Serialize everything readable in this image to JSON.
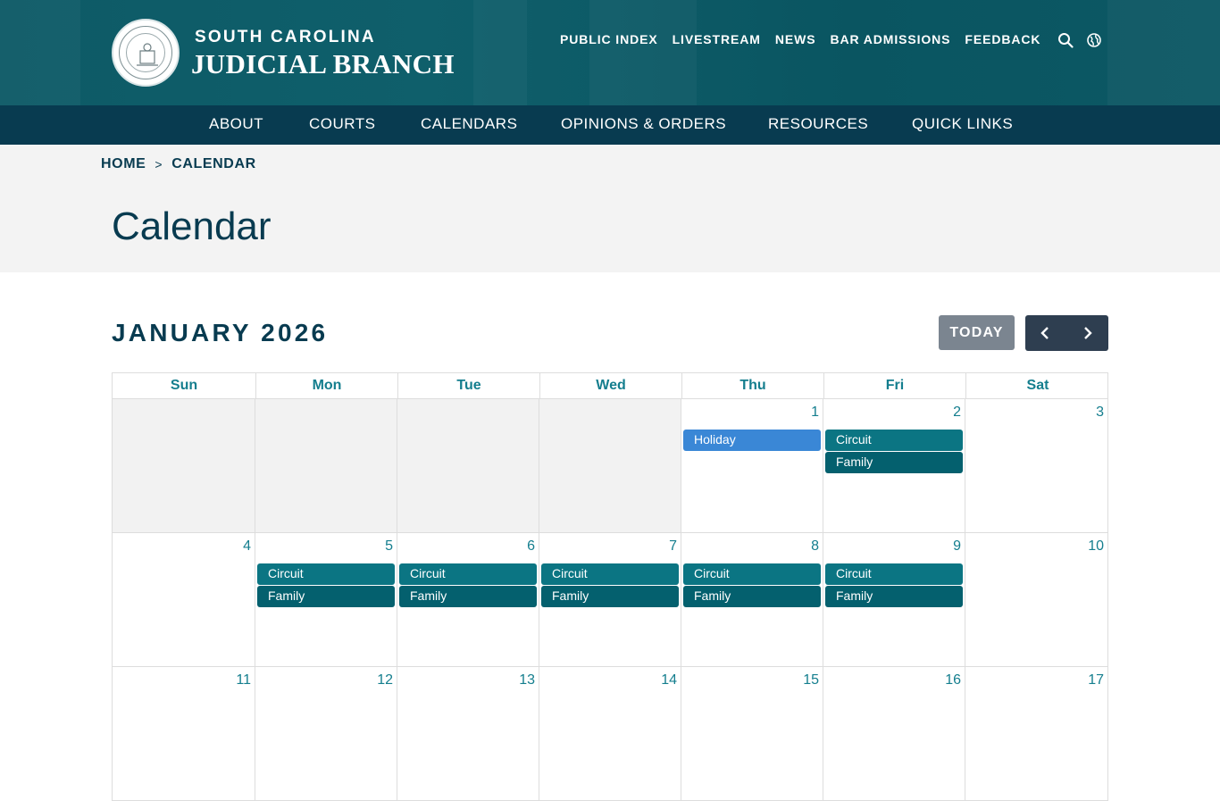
{
  "header": {
    "brand_small": "SOUTH CAROLINA",
    "brand_big": "JUDICIAL BRANCH",
    "seal_alt": "Supreme Court of South Carolina seal",
    "util_links": [
      "PUBLIC INDEX",
      "LIVESTREAM",
      "NEWS",
      "BAR ADMISSIONS",
      "FEEDBACK"
    ],
    "icons": [
      "search-icon",
      "globe-icon"
    ]
  },
  "nav": {
    "items": [
      "ABOUT",
      "COURTS",
      "CALENDARS",
      "OPINIONS & ORDERS",
      "RESOURCES",
      "QUICK LINKS"
    ]
  },
  "breadcrumb": {
    "home": "HOME",
    "separator": ">",
    "current": "CALENDAR"
  },
  "page": {
    "title": "Calendar"
  },
  "calendar": {
    "month_label": "JANUARY 2026",
    "today_label": "TODAY",
    "prev_icon": "chevron-left-icon",
    "next_icon": "chevron-right-icon",
    "weekdays": [
      "Sun",
      "Mon",
      "Tue",
      "Wed",
      "Thu",
      "Fri",
      "Sat"
    ],
    "weeks": [
      [
        {
          "day": "",
          "other": true,
          "events": []
        },
        {
          "day": "",
          "other": true,
          "events": []
        },
        {
          "day": "",
          "other": true,
          "events": []
        },
        {
          "day": "",
          "other": true,
          "events": []
        },
        {
          "day": "1",
          "other": false,
          "events": [
            {
              "label": "Holiday",
              "kind": "holiday"
            }
          ]
        },
        {
          "day": "2",
          "other": false,
          "events": [
            {
              "label": "Circuit",
              "kind": "circuit"
            },
            {
              "label": "Family",
              "kind": "family"
            }
          ]
        },
        {
          "day": "3",
          "other": false,
          "events": []
        }
      ],
      [
        {
          "day": "4",
          "other": false,
          "events": []
        },
        {
          "day": "5",
          "other": false,
          "events": [
            {
              "label": "Circuit",
              "kind": "circuit"
            },
            {
              "label": "Family",
              "kind": "family"
            }
          ]
        },
        {
          "day": "6",
          "other": false,
          "events": [
            {
              "label": "Circuit",
              "kind": "circuit"
            },
            {
              "label": "Family",
              "kind": "family"
            }
          ]
        },
        {
          "day": "7",
          "other": false,
          "events": [
            {
              "label": "Circuit",
              "kind": "circuit"
            },
            {
              "label": "Family",
              "kind": "family"
            }
          ]
        },
        {
          "day": "8",
          "other": false,
          "events": [
            {
              "label": "Circuit",
              "kind": "circuit"
            },
            {
              "label": "Family",
              "kind": "family"
            }
          ]
        },
        {
          "day": "9",
          "other": false,
          "events": [
            {
              "label": "Circuit",
              "kind": "circuit"
            },
            {
              "label": "Family",
              "kind": "family"
            }
          ]
        },
        {
          "day": "10",
          "other": false,
          "events": []
        }
      ],
      [
        {
          "day": "11",
          "other": false,
          "events": []
        },
        {
          "day": "12",
          "other": false,
          "events": []
        },
        {
          "day": "13",
          "other": false,
          "events": []
        },
        {
          "day": "14",
          "other": false,
          "events": []
        },
        {
          "day": "15",
          "other": false,
          "events": []
        },
        {
          "day": "16",
          "other": false,
          "events": []
        },
        {
          "day": "17",
          "other": false,
          "events": []
        }
      ]
    ]
  },
  "colors": {
    "header_teal": "#0d5a66",
    "nav_navy": "#083b50",
    "accent_teal": "#147e8e",
    "holiday_blue": "#3a87d6",
    "circuit_teal": "#0b7583",
    "family_teal": "#04606e",
    "today_gray": "#7b8590",
    "pager_dark": "#2e3e50"
  }
}
